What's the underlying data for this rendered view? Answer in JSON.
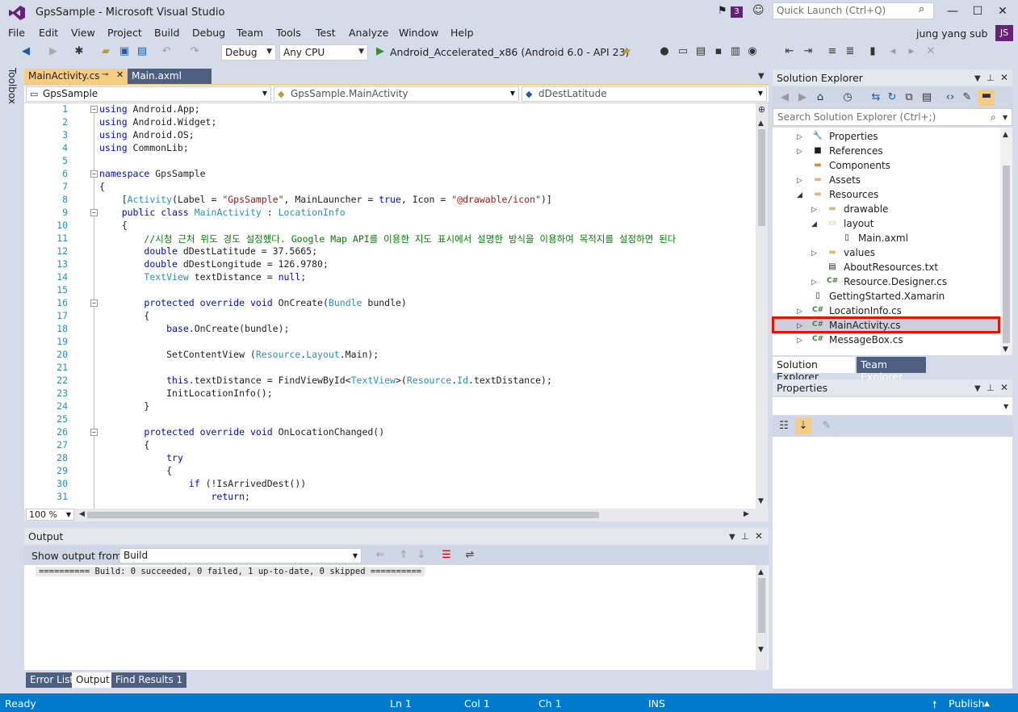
{
  "window": {
    "title": "GpsSample - Microsoft Visual Studio",
    "notification_count": "3",
    "quick_launch_placeholder": "Quick Launch (Ctrl+Q)",
    "controls": [
      "—",
      "☐",
      "✕"
    ]
  },
  "menu": [
    "File",
    "Edit",
    "View",
    "Project",
    "Build",
    "Debug",
    "Team",
    "Tools",
    "Test",
    "Analyze",
    "Window",
    "Help"
  ],
  "user": {
    "name": "jung yang sub",
    "initials": "JS"
  },
  "toolbar": {
    "configuration": "Debug",
    "platform": "Any CPU",
    "run_target": "Android_Accelerated_x86 (Android 6.0 - API 23)"
  },
  "toolbox_label": "Toolbox",
  "editor": {
    "tabs": [
      {
        "label": "MainActivity.cs",
        "active": true
      },
      {
        "label": "Main.axml",
        "active": false
      }
    ],
    "nav": {
      "project": "GpsSample",
      "class": "GpsSample.MainActivity",
      "member": "dDestLatitude"
    },
    "zoom": "100 %",
    "line_numbers": [
      "1",
      "2",
      "3",
      "4",
      "5",
      "6",
      "7",
      "8",
      "9",
      "10",
      "11",
      "12",
      "13",
      "14",
      "15",
      "16",
      "17",
      "18",
      "19",
      "20",
      "21",
      "22",
      "23",
      "24",
      "25",
      "26",
      "27",
      "28",
      "29",
      "30",
      "31"
    ]
  },
  "output": {
    "title": "Output",
    "show_from_label": "Show output from:",
    "source": "Build",
    "text": "========== Build: 0 succeeded, 0 failed, 1 up-to-date, 0 skipped ==========",
    "bottom_tabs": [
      "Error List",
      "Output",
      "Find Results 1"
    ]
  },
  "solution_explorer": {
    "title": "Solution Explorer",
    "search_placeholder": "Search Solution Explorer (Ctrl+;)",
    "items": [
      {
        "label": "Properties"
      },
      {
        "label": "References"
      },
      {
        "label": "Components"
      },
      {
        "label": "Assets"
      },
      {
        "label": "Resources"
      },
      {
        "label": "drawable"
      },
      {
        "label": "layout"
      },
      {
        "label": "Main.axml"
      },
      {
        "label": "values"
      },
      {
        "label": "AboutResources.txt"
      },
      {
        "label": "Resource.Designer.cs"
      },
      {
        "label": "GettingStarted.Xamarin"
      },
      {
        "label": "LocationInfo.cs"
      },
      {
        "label": "MainActivity.cs"
      },
      {
        "label": "MessageBox.cs"
      }
    ],
    "tabs": [
      "Solution Explorer",
      "Team Explorer"
    ]
  },
  "properties": {
    "title": "Properties"
  },
  "status": {
    "state": "Ready",
    "ln": "Ln 1",
    "col": "Col 1",
    "ch": "Ch 1",
    "mode": "INS",
    "publish": "Publish"
  },
  "colors": {
    "accent": "#007acc",
    "active_tab": "#f5cc84",
    "inactive_tab": "#4d6082",
    "chrome": "#d6dbe9",
    "highlight": "#e51400"
  }
}
